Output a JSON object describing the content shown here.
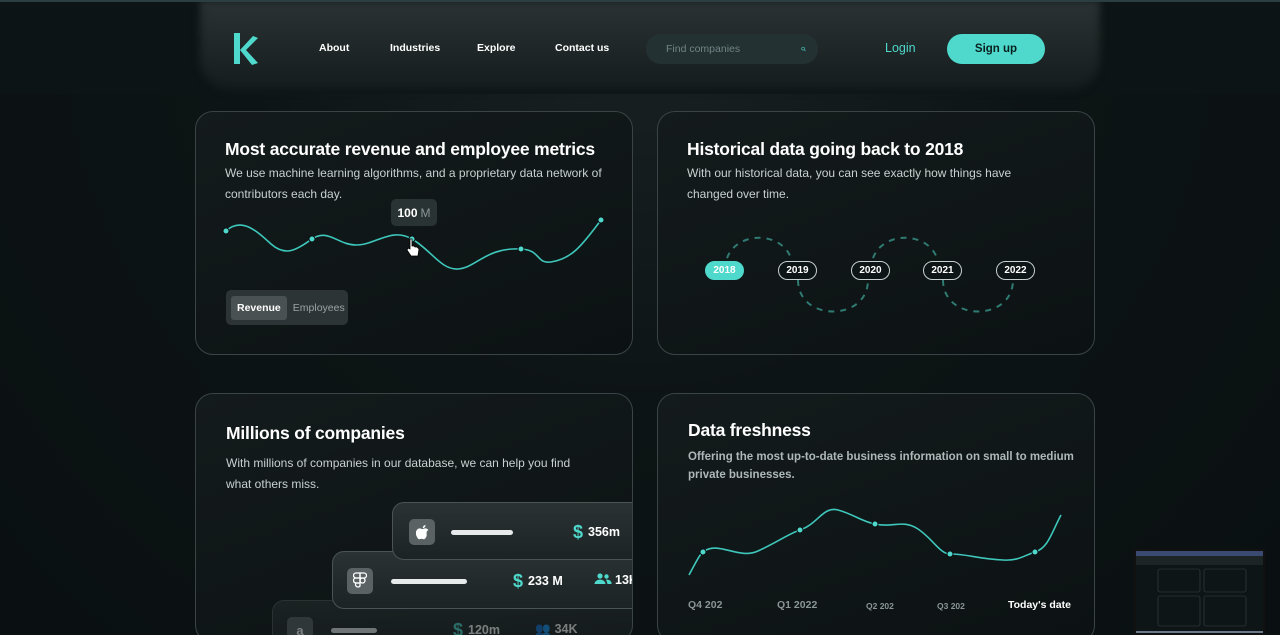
{
  "brand": {
    "logo_letter": "k",
    "accent": "#4fd8cc"
  },
  "nav": {
    "links": [
      "About",
      "Industries",
      "Explore",
      "Contact us"
    ],
    "search_placeholder": "Find companies",
    "login": "Login",
    "signup": "Sign up"
  },
  "cards": {
    "revenue": {
      "title": "Most accurate revenue and employee metrics",
      "description": "We use machine learning algorithms, and a proprietary data network of contributors each day.",
      "tooltip_value": "100",
      "tooltip_unit": "M",
      "toggle": [
        "Revenue",
        "Employees"
      ],
      "active_toggle": "Revenue"
    },
    "historical": {
      "title": "Historical data going back to 2018",
      "description": "With our historical data, you can see exactly how things have changed over time.",
      "years": [
        "2018",
        "2019",
        "2020",
        "2021",
        "2022"
      ],
      "active_year": "2018"
    },
    "companies": {
      "title": "Millions of companies",
      "description": "With millions of companies in our database, we can help you find what others miss.",
      "rows": [
        {
          "icon": "apple-icon",
          "glyph": "",
          "revenue": "356m",
          "employees": ""
        },
        {
          "icon": "figma-icon",
          "glyph": "",
          "revenue": "233 M",
          "employees": "13K"
        },
        {
          "icon": "amazon-icon",
          "glyph": "a",
          "revenue": "120m",
          "employees": "34K"
        }
      ]
    },
    "freshness": {
      "title": "Data freshness",
      "description": "Offering the most up-to-date business information on small to medium private businesses.",
      "labels": [
        "Q4 202",
        "Q1 2022",
        "Q2 202",
        "Q3 202",
        "Today's date"
      ]
    }
  }
}
